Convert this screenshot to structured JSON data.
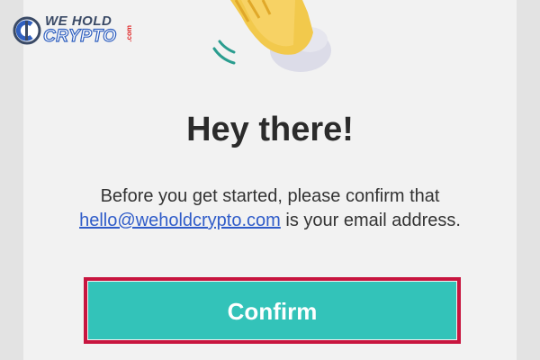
{
  "logo": {
    "line1": "WE HOLD",
    "line2": "CRYPTO",
    "suffix": ".com"
  },
  "hero": {
    "icon": "waving-hand-icon"
  },
  "main": {
    "title": "Hey there!",
    "message_before": "Before you get started, please confirm that ",
    "email": "hello@weholdcrypto.com",
    "message_after": " is your email address."
  },
  "actions": {
    "confirm_label": "Confirm"
  },
  "colors": {
    "accent": "#33c3b9",
    "highlight": "#c8153f",
    "link": "#2f5cc9"
  }
}
